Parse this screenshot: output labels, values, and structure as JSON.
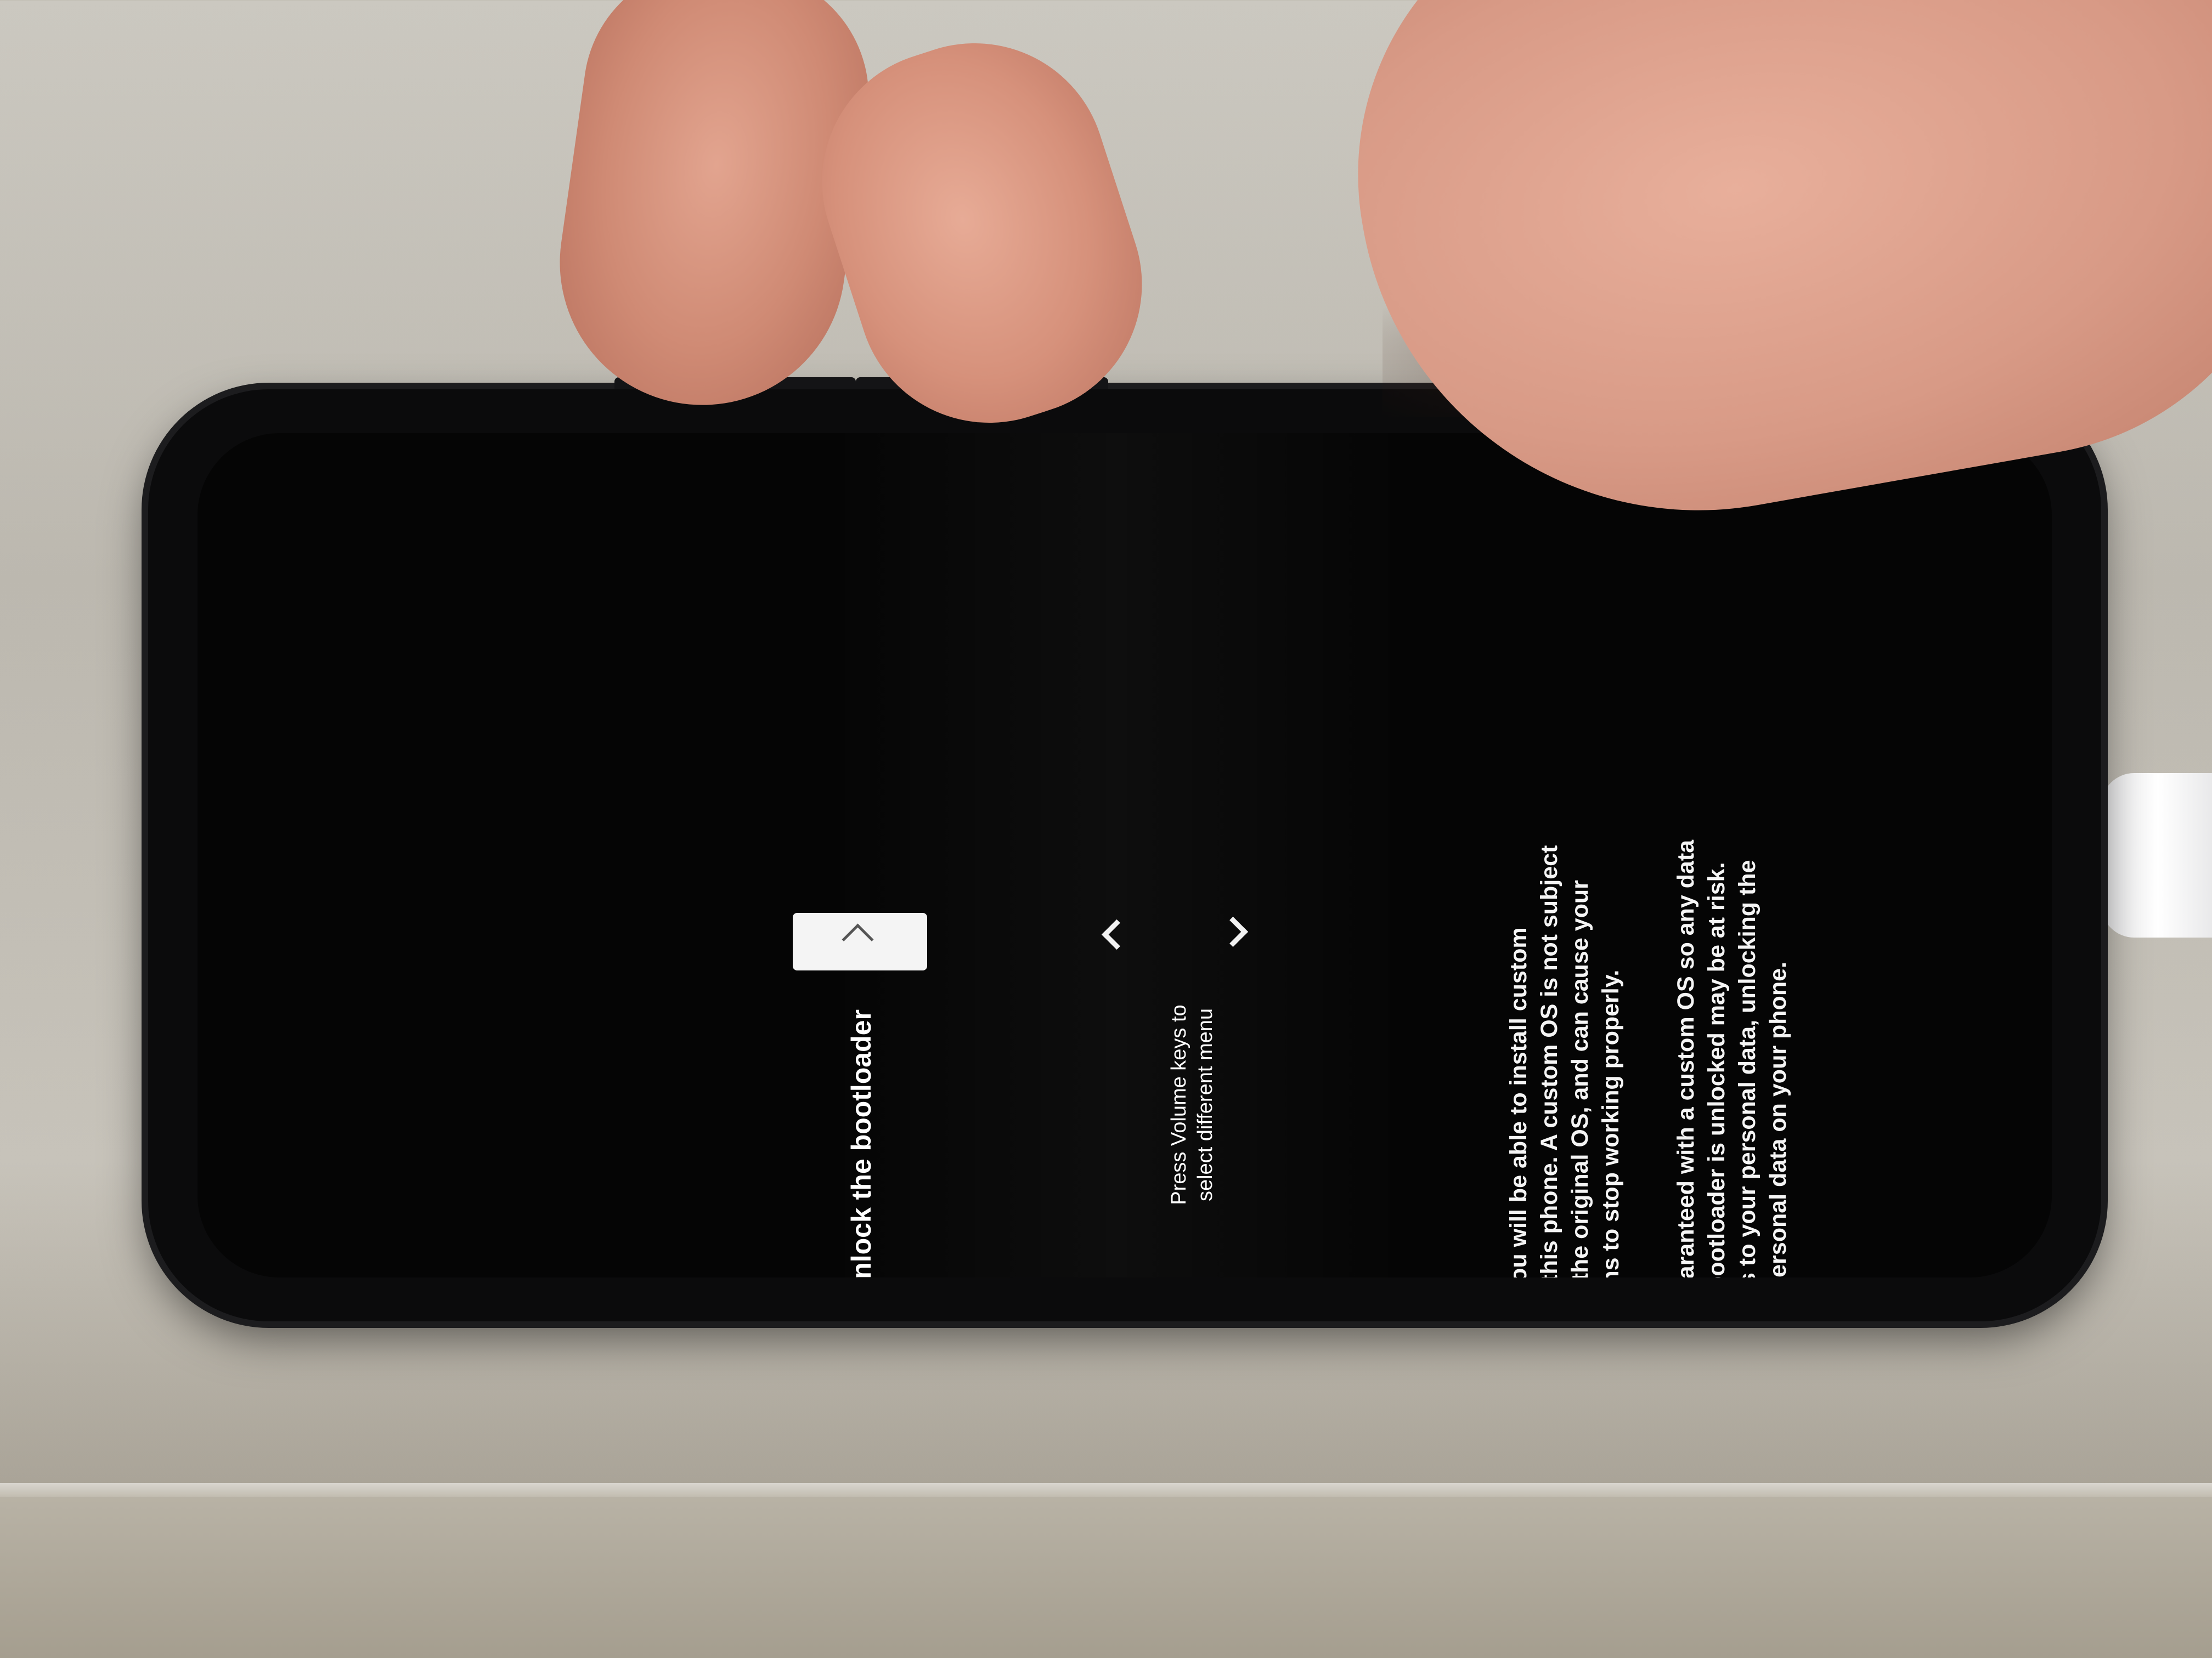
{
  "screen": {
    "menu_title": "Unlock the bootloader",
    "hint_line_1": "Press Volume keys to",
    "hint_line_2": "select different menu",
    "warning": {
      "paragraph_1": [
        "If you unlock the bootloader, you will be able to install custom",
        "operating system software on this phone. A custom OS is not subject",
        "to the same level of testing as the original OS, and can cause your",
        "phone and installed applications to stop working properly."
      ],
      "paragraph_2": [
        "Software integrity cannot be guaranteed with a custom OS so any data",
        "stored on the phone while the bootloader is unlocked may be at risk.",
        "To prevent unauthorized access to your personal data, unlocking the",
        "bootloader, will also delete all personal data on your phone."
      ]
    }
  },
  "icons": {
    "select": "chevron-up-icon",
    "prev": "chevron-left-icon",
    "next": "chevron-right-icon",
    "warning": "warning-triangle-icon"
  },
  "colors": {
    "screen_background": "#050505",
    "text": "#ffffff",
    "warning": "#f25a4a",
    "selector": "#f4f4f4"
  }
}
